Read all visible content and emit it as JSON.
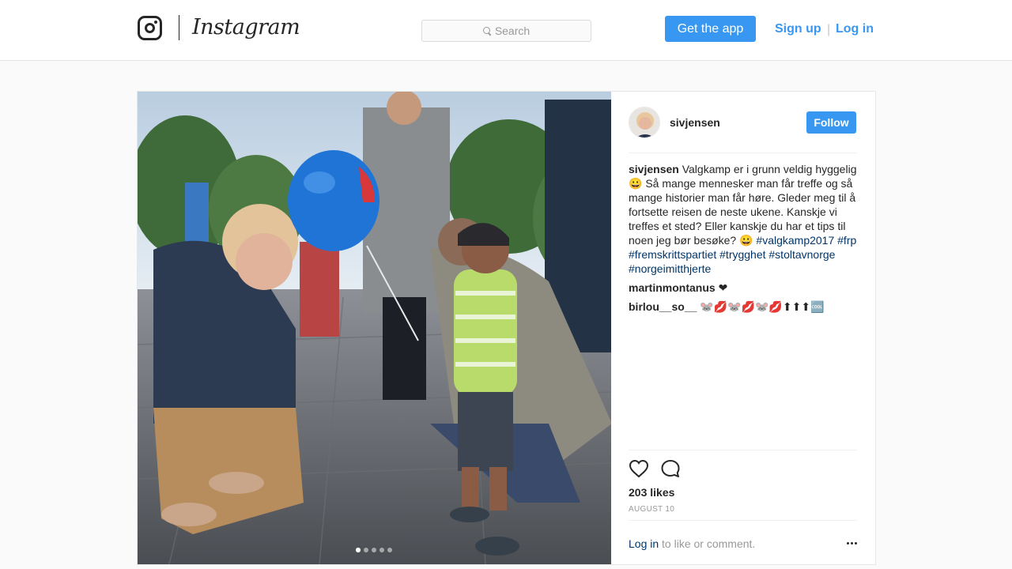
{
  "topbar": {
    "brand": "Instagram",
    "search_placeholder": "Search",
    "get_app": "Get the app",
    "sign_up": "Sign up",
    "separator": "|",
    "log_in": "Log in"
  },
  "post": {
    "username": "sivjensen",
    "follow": "Follow",
    "caption_user": "sivjensen",
    "caption_text": "Valgkamp er i grunn veldig hyggelig 😀 Så mange mennesker man får treffe og så mange historier man får høre. Gleder meg til å fortsette reisen de neste ukene. Kanskje vi treffes et sted? Eller kanskje du har et tips til noen jeg bør besøke? 😀",
    "hashtags": "#valgkamp2017 #frp #fremskrittspartiet #trygghet #stoltavnorge #norgeimitthjerte",
    "comments": [
      {
        "user": "martinmontanus",
        "text": "❤"
      },
      {
        "user": "birlou__so__",
        "text": "🐭💋🐭💋🐭💋⬆⬆⬆🆒"
      }
    ],
    "likes": "203 likes",
    "date": "AUGUST 10",
    "login_link": "Log in",
    "login_suffix": " to like or comment.",
    "carousel": {
      "count": 5,
      "active": 0
    }
  },
  "colors": {
    "accent": "#3897f0",
    "tag": "#003569"
  }
}
